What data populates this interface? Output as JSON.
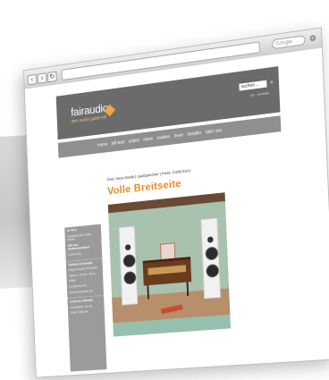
{
  "browser": {
    "search_placeholder": "Google"
  },
  "header": {
    "logo": "fairaudio",
    "tagline": "dein audio guide hifi",
    "search_value": "suchen ...",
    "links": "rss · kontakt"
  },
  "nav": {
    "items": [
      "home",
      "hifi-test",
      "artikel",
      "news",
      "rookies",
      "leser",
      "händler",
      "über uns"
    ]
  },
  "article": {
    "test_line": "Test: Hess Direkt | Lautsprecher | Preis: 3.000 Euro",
    "headline": "Volle Breitseite"
  },
  "sidebar": {
    "lines": [
      "im Test",
      "Lautsprecher: Hess Direkt",
      "HiFi aus Süddeutschland",
      "3.000 Euro",
      "Vertrieb & Kontakt",
      "Magnat Audio-Produkte",
      "Telefon: 02234 - 8071",
      "eMail:",
      "info@hess.de",
      "www.hessaudio.de",
      "Links des Monats",
      "Goodfellas: Ja am",
      "Rotel: DAB-Sx"
    ]
  },
  "colors": {
    "accent": "#e58a1f",
    "header_bg": "#6b6b6b",
    "nav_bg": "#8f8f8f",
    "sidebar_bg": "#9b9b9b"
  }
}
